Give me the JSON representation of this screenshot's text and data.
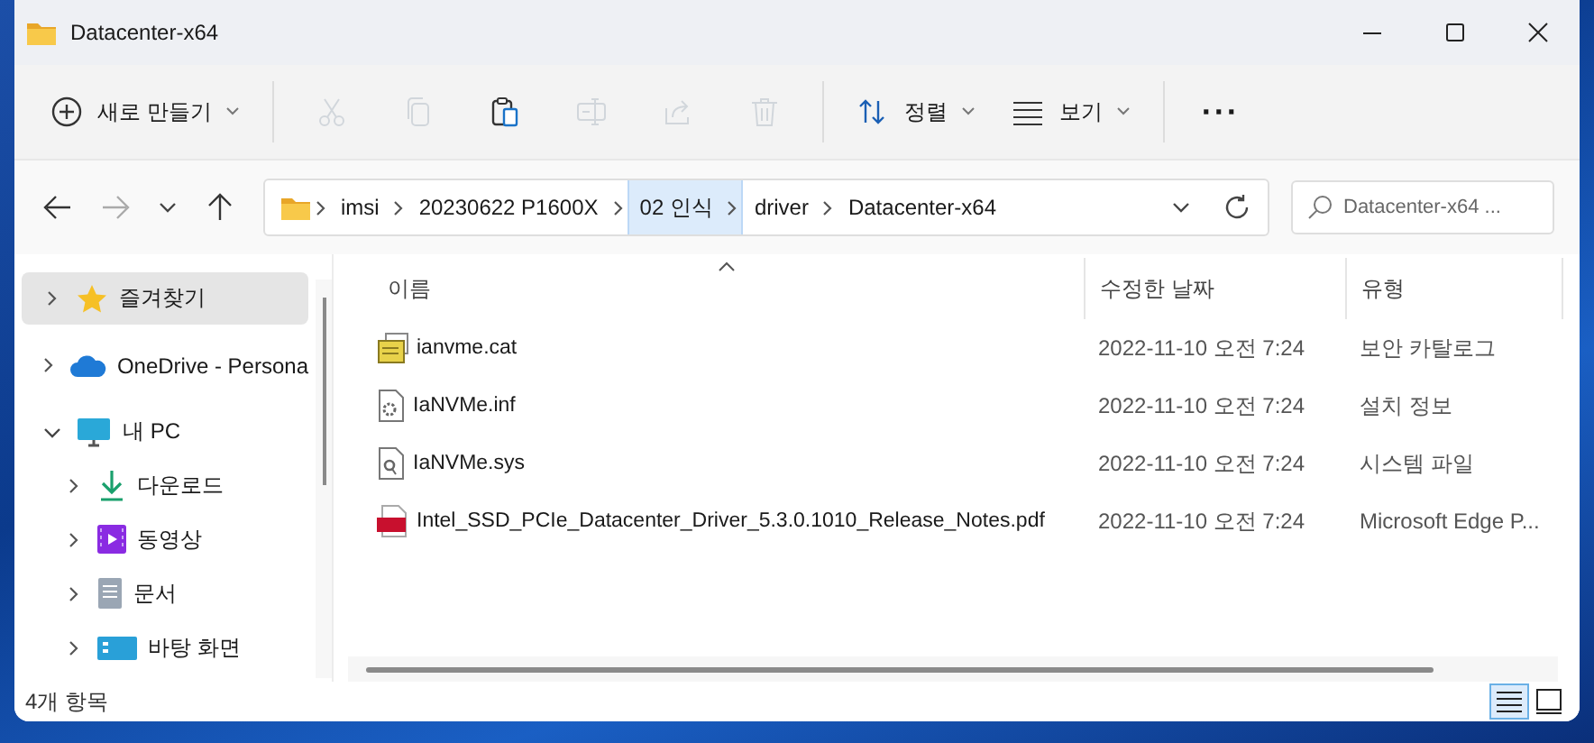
{
  "window": {
    "title": "Datacenter-x64"
  },
  "toolbar": [
    {
      "kind": "new",
      "label": "새로 만들기",
      "disabled": false
    },
    {
      "kind": "cut",
      "disabled": true
    },
    {
      "kind": "copy",
      "disabled": true
    },
    {
      "kind": "paste",
      "disabled": false
    },
    {
      "kind": "rename",
      "disabled": true
    },
    {
      "kind": "share",
      "disabled": true
    },
    {
      "kind": "delete",
      "disabled": true
    },
    {
      "kind": "sort",
      "label": "정렬",
      "disabled": false
    },
    {
      "kind": "view",
      "label": "보기",
      "disabled": false
    },
    {
      "kind": "more",
      "label": "···",
      "disabled": false
    }
  ],
  "navigation": {
    "back_disabled": false,
    "forward_disabled": true
  },
  "address": {
    "segments": [
      {
        "label": "imsi",
        "selected": false
      },
      {
        "label": "20230622 P1600X",
        "selected": false
      },
      {
        "label": "02 인식",
        "selected": true
      },
      {
        "label": "driver",
        "selected": false
      },
      {
        "label": "Datacenter-x64",
        "selected": false
      }
    ]
  },
  "search": {
    "placeholder": "Datacenter-x64 ..."
  },
  "sidebar": {
    "items": [
      {
        "kind": "favorites",
        "label": "즐겨찾기",
        "selected": true,
        "expanded": false
      },
      {
        "kind": "cloud",
        "label": "OneDrive - Persona",
        "selected": false,
        "expanded": false
      },
      {
        "kind": "pc",
        "label": "내 PC",
        "selected": false,
        "expanded": true,
        "children": [
          {
            "kind": "download",
            "label": "다운로드",
            "selected": false,
            "expanded": false
          },
          {
            "kind": "video",
            "label": "동영상",
            "selected": false,
            "expanded": false
          },
          {
            "kind": "document",
            "label": "문서",
            "selected": false,
            "expanded": false
          },
          {
            "kind": "desktop",
            "label": "바탕 화면",
            "selected": false,
            "expanded": false
          }
        ]
      }
    ]
  },
  "table": {
    "columns": [
      {
        "label": "이름",
        "sorted": true
      },
      {
        "label": "수정한 날짜"
      },
      {
        "label": "유형"
      }
    ],
    "rows": [
      {
        "kind": "catalog",
        "name": "ianvme.cat",
        "modified": "2022-11-10 오전 7:24",
        "type": "보안 카탈로그"
      },
      {
        "kind": "inf",
        "name": "IaNVMe.inf",
        "modified": "2022-11-10 오전 7:24",
        "type": "설치 정보"
      },
      {
        "kind": "sys",
        "name": "IaNVMe.sys",
        "modified": "2022-11-10 오전 7:24",
        "type": "시스템 파일"
      },
      {
        "kind": "pdf",
        "name": "Intel_SSD_PCIe_Datacenter_Driver_5.3.0.1010_Release_Notes.pdf",
        "modified": "2022-11-10 오전 7:24",
        "type": "Microsoft Edge P..."
      }
    ]
  },
  "status_bar": {
    "count": "4개 항목",
    "views": [
      {
        "selected": true
      },
      {
        "selected": false
      }
    ]
  }
}
